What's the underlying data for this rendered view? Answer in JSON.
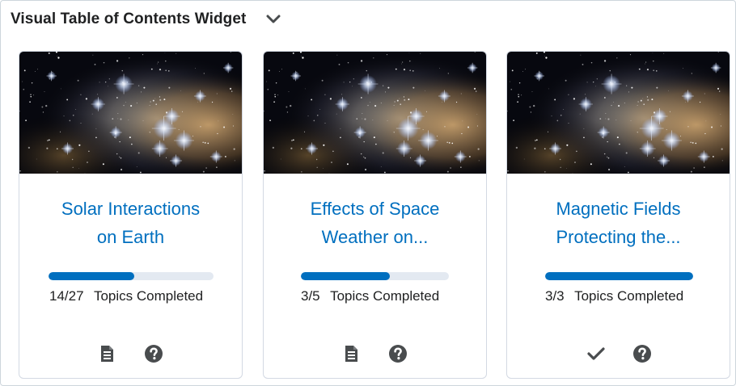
{
  "widget": {
    "title": "Visual Table of Contents Widget",
    "collapse_icon": "chevron-down-icon"
  },
  "colors": {
    "accent": "#006fbf",
    "track": "#e3e9f1",
    "icon": "#494c4e"
  },
  "cards": [
    {
      "title_lines": [
        "Solar Interactions",
        "on Earth"
      ],
      "completed": "14/27",
      "status_label": "Topics Completed",
      "progress": 0.52,
      "icons": [
        "document-icon",
        "help-icon"
      ]
    },
    {
      "title_lines": [
        "Effects of Space",
        "Weather on..."
      ],
      "completed": "3/5",
      "status_label": "Topics Completed",
      "progress": 0.6,
      "icons": [
        "document-icon",
        "help-icon"
      ]
    },
    {
      "title_lines": [
        "Magnetic Fields",
        "Protecting the..."
      ],
      "completed": "3/3",
      "status_label": "Topics Completed",
      "progress": 1.0,
      "icons": [
        "checkmark-icon",
        "help-icon"
      ]
    }
  ]
}
